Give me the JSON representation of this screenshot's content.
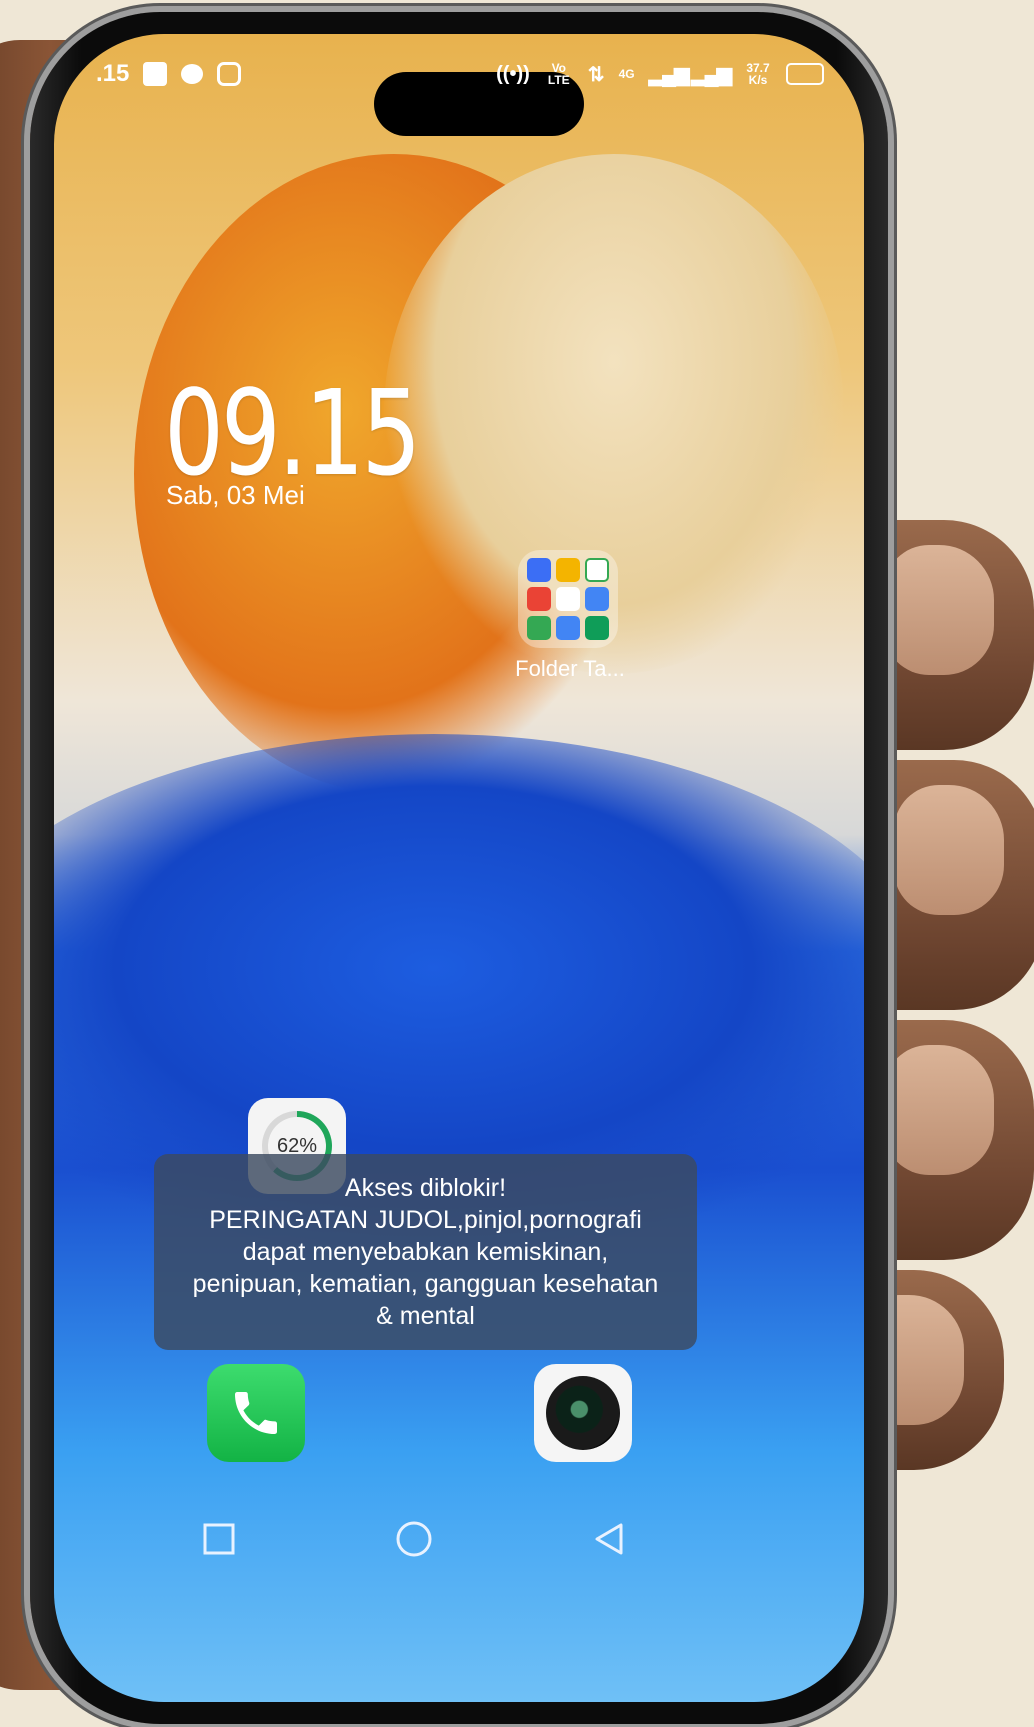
{
  "status_bar": {
    "time": ".15",
    "network": "Vo LTE",
    "signal_type": "4G",
    "data_speed": "37.7 K/s",
    "icons": [
      "notification-icon",
      "chat-bubble-icon",
      "instagram-icon",
      "hotspot-icon",
      "data-transfer-icon",
      "signal-icon",
      "battery-icon"
    ]
  },
  "lock_clock": {
    "time": "09.15",
    "date": "Sab, 03 Mei"
  },
  "home_screen": {
    "folder": {
      "label": "Folder Ta...",
      "app_icon_colors": [
        "#3b6ef5",
        "#f4b400",
        "#34a853",
        "#ea4335",
        "#ffffff",
        "#4285f4",
        "#34a853",
        "#4285f4",
        "#0f9d58"
      ]
    },
    "widget": {
      "percent_label": "62%",
      "progress_fraction": 0.62
    },
    "dock": [
      {
        "app": "Phone",
        "icon": "phone-icon",
        "color": "#1fc85a"
      },
      {
        "app": "Camera",
        "icon": "camera-icon",
        "color": "#f5f5f5"
      }
    ]
  },
  "toast": {
    "title": "Akses diblokir!",
    "lines": [
      "PERINGATAN JUDOL,pinjol,pornografi",
      "dapat menyebabkan kemiskinan,",
      "penipuan, kematian, gangguan kesehatan",
      "& mental"
    ]
  },
  "nav_bar": [
    "recents-square-icon",
    "home-circle-icon",
    "back-triangle-icon"
  ]
}
